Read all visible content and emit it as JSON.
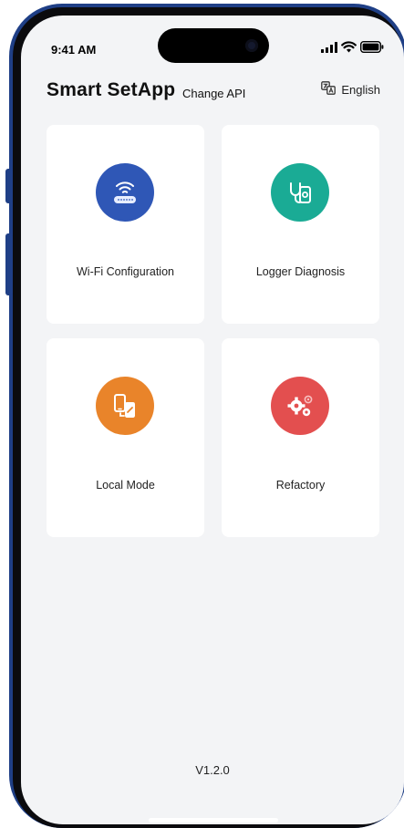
{
  "status_bar": {
    "time": "9:41 AM"
  },
  "header": {
    "title": "Smart SetApp",
    "change_api_label": "Change API",
    "language_label": "English"
  },
  "cards": [
    {
      "label": "Wi-Fi Configuration",
      "icon": "wifi-router-icon",
      "color": "#2f57b6"
    },
    {
      "label": "Logger Diagnosis",
      "icon": "stethoscope-phone-icon",
      "color": "#1aab95"
    },
    {
      "label": "Local Mode",
      "icon": "phone-transfer-icon",
      "color": "#e9842a"
    },
    {
      "label": "Refactory",
      "icon": "gears-icon",
      "color": "#e34f4f"
    }
  ],
  "footer": {
    "version": "V1.2.0"
  },
  "colors": {
    "frame": "#1f3f86",
    "background": "#f3f4f6",
    "card": "#ffffff"
  }
}
